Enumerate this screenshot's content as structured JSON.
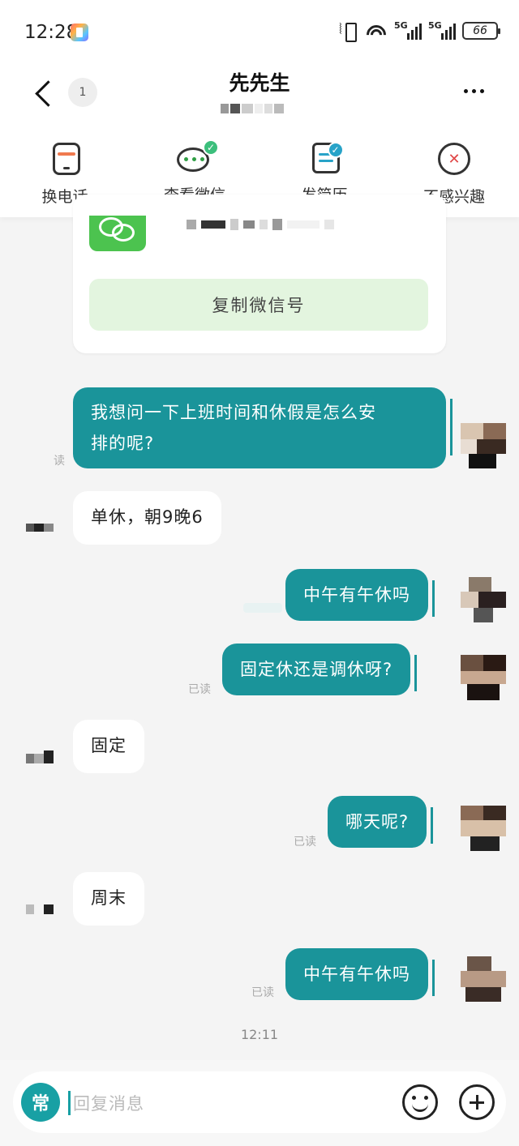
{
  "status_bar": {
    "time": "12:28",
    "network_1": "5G",
    "network_2": "5G",
    "battery": "66"
  },
  "header": {
    "contact_name": "先先生",
    "unread_count": "1"
  },
  "actions": [
    {
      "label": "换电话",
      "icon": "phone-icon"
    },
    {
      "label": "查看微信",
      "icon": "wechat-icon"
    },
    {
      "label": "发简历",
      "icon": "resume-icon"
    },
    {
      "label": "不感兴趣",
      "icon": "not-interested-icon"
    }
  ],
  "wechat_card": {
    "copy_label": "复制微信号"
  },
  "messages": [
    {
      "direction": "out",
      "text": "我想问一下上班时间和休假是怎么安排的呢?",
      "line1": "我想问一下上班时间和休假是怎么安",
      "line2": "排的呢?",
      "read": "读"
    },
    {
      "direction": "in",
      "text": "单休，朝9晚6"
    },
    {
      "direction": "out",
      "text": "中午有午休吗",
      "read": ""
    },
    {
      "direction": "out",
      "text": "固定休还是调休呀?",
      "read": "已读"
    },
    {
      "direction": "in",
      "text": "固定"
    },
    {
      "direction": "out",
      "text": "哪天呢?",
      "read": "已读"
    },
    {
      "direction": "in",
      "text": "周末"
    },
    {
      "direction": "out",
      "text": "中午有午休吗",
      "read": "已读"
    }
  ],
  "timestamp": "12:11",
  "input": {
    "phrase_button": "常",
    "placeholder": "回复消息"
  },
  "colors": {
    "outgoing_bubble": "#1a949a",
    "accent": "#18a0a4",
    "wechat_green": "#4cc34f",
    "copy_button_bg": "#e3f5df"
  }
}
